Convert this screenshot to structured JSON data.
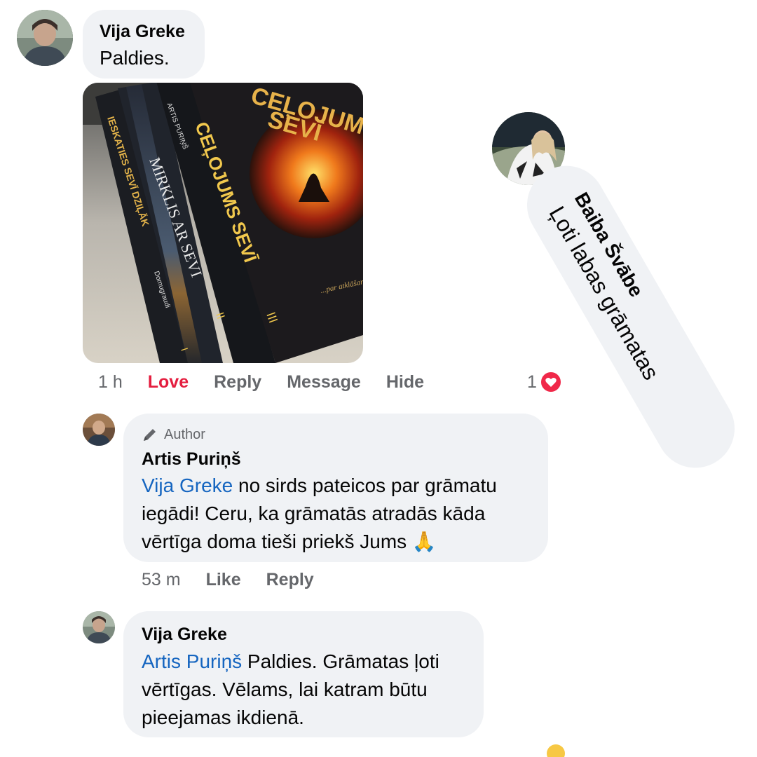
{
  "comment1": {
    "author": "Vija Greke",
    "text": "Paldies.",
    "time": "1 h",
    "actions": {
      "love": "Love",
      "reply": "Reply",
      "message": "Message",
      "hide": "Hide"
    },
    "reaction_count": "1",
    "photo": {
      "book1_title": "CEĻOJUMS SEVĪ",
      "book1_author": "ARTIS PURIŅŠ",
      "book1_num": "III",
      "book1_sub": "...par atklāšanās ceļu",
      "book2_title": "CEĻOJUMS SEVĪ",
      "book2_num": "II",
      "book3_title": "MIRKLIS AR SEVI",
      "book3_num": "II",
      "book4_title": "IESKATIES SEVĪ DZIĻĀK",
      "book4_sub": "Domugraudi",
      "book4_num": "I"
    }
  },
  "rotated_comment": {
    "author": "Baiba Švābe",
    "text": "Ļoti labas grāmatas"
  },
  "reply1": {
    "badge": "Author",
    "author": "Artis Puriņš",
    "mention": "Vija Greke",
    "line1_rest": " no sirds pateicos par grāmatu",
    "line2": "iegādi! Ceru, ka grāmatās atradās kāda",
    "line3": "vērtīga doma tieši priekš Jums ",
    "emoji": "🙏",
    "time": "53 m",
    "like": "Like",
    "reply": "Reply"
  },
  "reply2": {
    "author": "Vija Greke",
    "mention": "Artis Puriņš",
    "line1_rest": " Paldies. Grāmatas ļoti",
    "line2": "vērtīgas. Vēlams, lai katram būtu",
    "line3": "pieejamas ikdienā."
  },
  "colors": {
    "bubble": "#f0f2f5",
    "meta": "#65676b",
    "love": "#e41e3f",
    "mention": "#1565c0",
    "heart": "#f02849"
  }
}
